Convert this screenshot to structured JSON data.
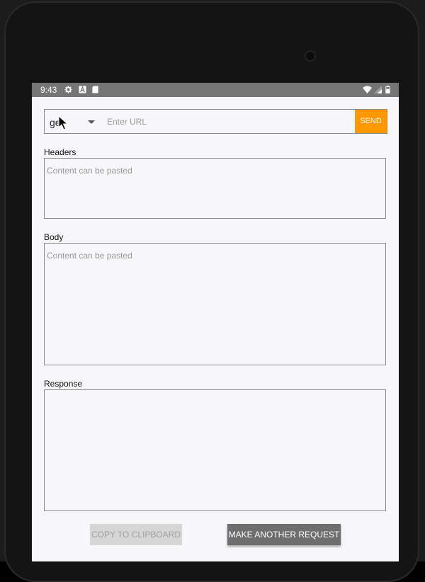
{
  "statusbar": {
    "time": "9:43",
    "icons": [
      "settings-icon",
      "font-a-icon",
      "sd-card-icon",
      "wifi-icon",
      "signal-icon",
      "battery-icon"
    ]
  },
  "request": {
    "method": "ge",
    "url_placeholder": "Enter URL",
    "url_value": "",
    "send_label": "SEND"
  },
  "headers": {
    "label": "Headers",
    "placeholder": "Content can be pasted"
  },
  "body": {
    "label": "Body",
    "placeholder": "Content can be pasted"
  },
  "response": {
    "label": "Response",
    "value": ""
  },
  "actions": {
    "copy_label": "COPY TO CLIPBOARD",
    "make_request_label": "MAKE ANOTHER REQUEST"
  },
  "colors": {
    "accent": "#ff9800",
    "statusbar": "#757575",
    "background": "#f7f6f9"
  }
}
